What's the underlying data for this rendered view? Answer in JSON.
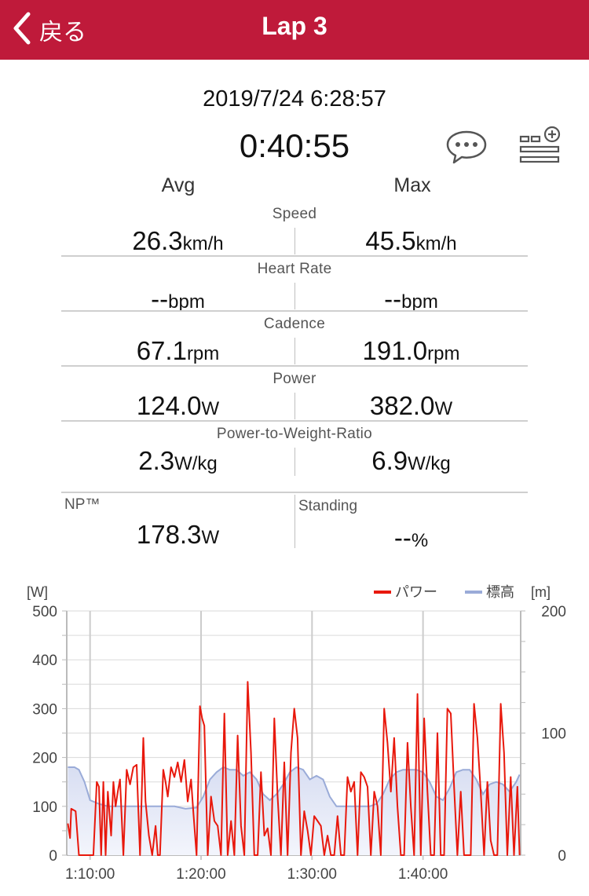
{
  "header": {
    "back_label": "戻る",
    "title": "Lap 3",
    "bar_color": "#bf1a3a"
  },
  "summary": {
    "date": "2019/7/24 6:28:57",
    "duration": "0:40:55",
    "comment_icon": "speech-bubble-icon",
    "settings_icon": "list-add-icon"
  },
  "stats": {
    "avg_label": "Avg",
    "max_label": "Max",
    "rows": [
      {
        "label": "Speed",
        "avg": "26.3",
        "avg_unit": "km/h",
        "max": "45.5",
        "max_unit": "km/h"
      },
      {
        "label": "Heart Rate",
        "avg": "--",
        "avg_unit": "bpm",
        "max": "--",
        "max_unit": "bpm"
      },
      {
        "label": "Cadence",
        "avg": "67.1",
        "avg_unit": "rpm",
        "max": "191.0",
        "max_unit": "rpm"
      },
      {
        "label": "Power",
        "avg": "124.0",
        "avg_unit": "W",
        "max": "382.0",
        "max_unit": "W"
      },
      {
        "label": "Power-to-Weight-Ratio",
        "avg": "2.3",
        "avg_unit": "W/kg",
        "max": "6.9",
        "max_unit": "W/kg"
      }
    ],
    "np": {
      "label": "NP™",
      "value": "178.3",
      "unit": "W"
    },
    "standing": {
      "label": "Standing",
      "value": "--",
      "unit": "%"
    }
  },
  "chart_data": {
    "type": "line",
    "y_left_unit": "[W]",
    "y_right_unit": "[m]",
    "y_left_ticks": [
      "0",
      "100",
      "200",
      "300",
      "400",
      "500"
    ],
    "y_right_ticks": [
      "0",
      "100",
      "200"
    ],
    "x_ticks": [
      "1:10:00",
      "1:20:00",
      "1:30:00",
      "1:40:00"
    ],
    "ylim_left": [
      0,
      500
    ],
    "ylim_right": [
      0,
      200
    ],
    "xlim_minutes": [
      67.9,
      108.8
    ],
    "grid": true,
    "legend_position": "top-right",
    "series": [
      {
        "name": "パワー",
        "axis": "left",
        "color": "#e8180c",
        "x_minutes": [
          68.0,
          68.2,
          68.3,
          68.7,
          69.0,
          69.5,
          70.0,
          70.3,
          70.6,
          70.8,
          71.0,
          71.2,
          71.4,
          71.6,
          71.9,
          72.1,
          72.3,
          72.5,
          72.7,
          73.0,
          73.3,
          73.6,
          73.9,
          74.2,
          74.5,
          74.8,
          75.0,
          75.3,
          75.6,
          75.9,
          76.1,
          76.3,
          76.6,
          76.8,
          77.0,
          77.3,
          77.6,
          77.9,
          78.2,
          78.5,
          78.8,
          79.1,
          79.3,
          79.6,
          79.9,
          80.1,
          80.3,
          80.6,
          80.9,
          81.2,
          81.5,
          81.8,
          82.1,
          82.4,
          82.7,
          83.0,
          83.3,
          83.6,
          83.9,
          84.2,
          84.5,
          84.8,
          85.1,
          85.4,
          85.7,
          86.0,
          86.3,
          86.6,
          86.9,
          87.2,
          87.5,
          87.8,
          88.1,
          88.4,
          88.7,
          89.0,
          89.3,
          89.6,
          89.9,
          90.2,
          90.5,
          90.8,
          91.1,
          91.4,
          91.7,
          92.0,
          92.3,
          92.6,
          92.9,
          93.2,
          93.5,
          93.8,
          94.1,
          94.4,
          94.7,
          95.0,
          95.3,
          95.6,
          95.9,
          96.2,
          96.5,
          96.8,
          97.1,
          97.4,
          97.7,
          98.0,
          98.3,
          98.6,
          98.9,
          99.2,
          99.5,
          99.8,
          100.1,
          100.4,
          100.7,
          101.0,
          101.3,
          101.6,
          101.9,
          102.2,
          102.5,
          102.8,
          103.1,
          103.4,
          103.7,
          104.0,
          104.3,
          104.6,
          104.9,
          105.2,
          105.5,
          105.8,
          106.1,
          106.4,
          106.7,
          107.0,
          107.3,
          107.6,
          107.9,
          108.2,
          108.5,
          108.7
        ],
        "values": [
          65,
          35,
          95,
          90,
          0,
          0,
          0,
          0,
          150,
          140,
          0,
          150,
          0,
          130,
          40,
          150,
          100,
          130,
          155,
          0,
          175,
          145,
          180,
          185,
          0,
          240,
          110,
          40,
          0,
          60,
          0,
          0,
          175,
          150,
          120,
          180,
          160,
          190,
          150,
          195,
          110,
          155,
          90,
          0,
          305,
          280,
          265,
          0,
          120,
          70,
          60,
          0,
          290,
          0,
          70,
          0,
          245,
          60,
          0,
          355,
          210,
          0,
          0,
          170,
          40,
          55,
          0,
          280,
          120,
          0,
          190,
          0,
          210,
          300,
          240,
          0,
          90,
          50,
          0,
          80,
          70,
          60,
          0,
          40,
          0,
          0,
          80,
          0,
          0,
          160,
          130,
          150,
          0,
          170,
          160,
          140,
          0,
          130,
          100,
          0,
          300,
          230,
          130,
          240,
          100,
          0,
          0,
          230,
          100,
          0,
          330,
          0,
          280,
          130,
          0,
          0,
          250,
          0,
          0,
          300,
          290,
          140,
          0,
          130,
          0,
          0,
          0,
          310,
          240,
          130,
          0,
          150,
          30,
          0,
          0,
          310,
          210,
          0,
          160,
          0,
          140,
          0,
          260,
          220,
          170,
          230,
          170
        ],
        "avg": 124.0,
        "max": 382.0
      },
      {
        "name": "標高",
        "axis": "right",
        "color": "#9aabd8",
        "x_minutes": [
          68.0,
          68.6,
          69.0,
          69.5,
          70.0,
          70.8,
          71.6,
          72.6,
          73.6,
          74.6,
          75.6,
          76.6,
          77.6,
          78.6,
          79.6,
          80.2,
          80.8,
          81.4,
          82.0,
          82.6,
          83.2,
          83.8,
          84.4,
          85.0,
          85.6,
          86.2,
          86.8,
          87.4,
          88.0,
          88.6,
          89.2,
          89.8,
          90.4,
          91.0,
          91.6,
          92.2,
          92.8,
          93.4,
          94.0,
          94.6,
          95.2,
          95.8,
          96.4,
          97.0,
          97.6,
          98.2,
          98.8,
          99.4,
          100.0,
          100.6,
          101.2,
          101.8,
          102.4,
          103.0,
          103.6,
          104.2,
          104.8,
          105.4,
          106.0,
          106.6,
          107.2,
          107.8,
          108.4,
          108.7
        ],
        "values": [
          72,
          72,
          70,
          60,
          45,
          42,
          40,
          40,
          40,
          40,
          40,
          40,
          40,
          38,
          39,
          48,
          62,
          68,
          72,
          70,
          70,
          65,
          68,
          62,
          50,
          45,
          50,
          58,
          68,
          72,
          70,
          62,
          65,
          62,
          48,
          40,
          40,
          40,
          40,
          40,
          40,
          42,
          50,
          62,
          68,
          70,
          70,
          70,
          68,
          60,
          48,
          45,
          55,
          68,
          70,
          70,
          62,
          50,
          58,
          60,
          58,
          52,
          60,
          66
        ]
      }
    ]
  }
}
